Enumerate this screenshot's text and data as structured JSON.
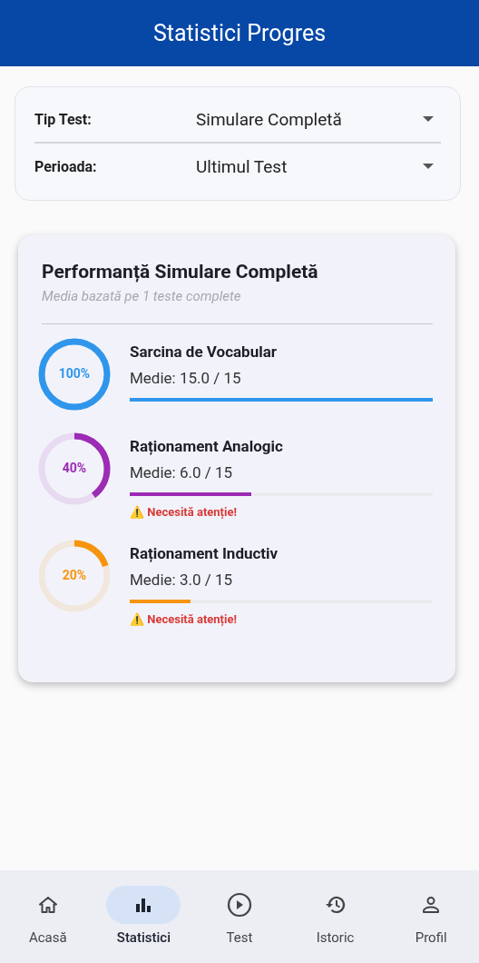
{
  "app_bar": {
    "title": "Statistici Progres"
  },
  "filters": [
    {
      "label": "Tip Test:",
      "value": "Simulare Completă"
    },
    {
      "label": "Perioada:",
      "value": "Ultimul Test"
    }
  ],
  "performance": {
    "title": "Performanță Simulare Completă",
    "subtitle": "Media bazată pe 1 teste complete",
    "categories": [
      {
        "name": "Sarcina de Vocabular",
        "percent": "100%",
        "average": "Medie: 15.0 / 15",
        "level": 1,
        "color": "#2f96ec"
      },
      {
        "name": "Raționament Analogic",
        "percent": "40%",
        "average": "Medie: 6.0 / 15",
        "level": 0.4,
        "color": "#9c2bb5",
        "warning": "⚠️ Necesită atenție!"
      },
      {
        "name": "Raționament Inductiv",
        "percent": "20%",
        "average": "Medie: 3.0 / 15",
        "level": 0.2,
        "color": "#f7940f",
        "warning": "⚠️ Necesită atenție!"
      }
    ]
  },
  "bottom_nav": [
    {
      "label": "Acasă",
      "kind": "home",
      "selected": false
    },
    {
      "label": "Statistici",
      "kind": "chart",
      "selected": true
    },
    {
      "label": "Test",
      "kind": "play",
      "selected": false
    },
    {
      "label": "Istoric",
      "kind": "history",
      "selected": false
    },
    {
      "label": "Profil",
      "kind": "person",
      "selected": false
    }
  ]
}
